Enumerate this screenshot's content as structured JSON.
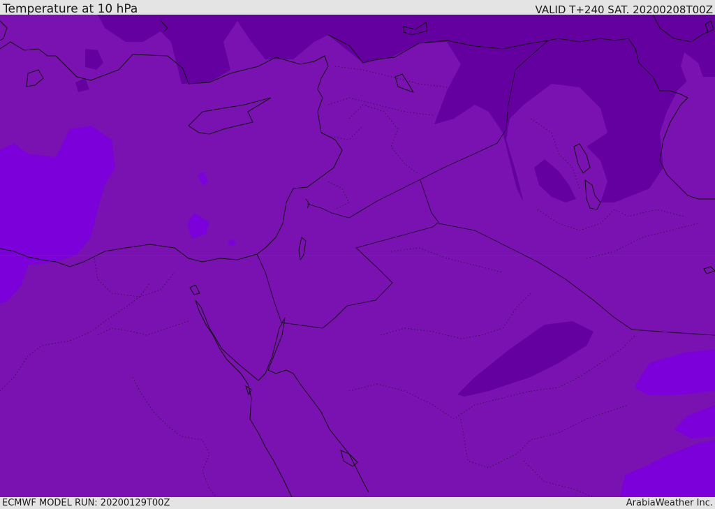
{
  "header": {
    "title": "Temperature at 10 hPa",
    "valid": "VALID T+240 SAT. 20200208T00Z"
  },
  "footer": {
    "model_run": "ECMWF MODEL RUN: 20200129T00Z",
    "credit": "ArabiaWeather Inc."
  },
  "map": {
    "type": "filled temperature contour map",
    "colors": {
      "base_fill": "#7a12b1",
      "cold_band": "#6500a0",
      "warm_band": "#7c00d9",
      "coastline": "#111111",
      "internal_border": "#2a0a3a"
    }
  }
}
